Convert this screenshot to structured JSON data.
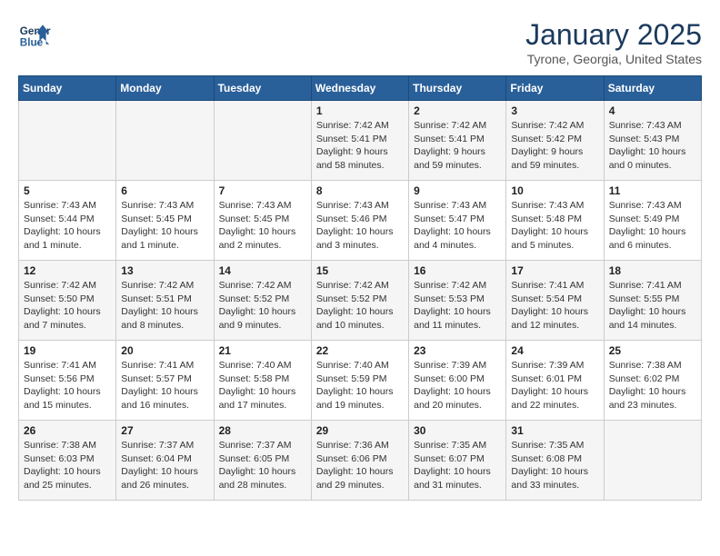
{
  "header": {
    "logo_line1": "General",
    "logo_line2": "Blue",
    "month": "January 2025",
    "location": "Tyrone, Georgia, United States"
  },
  "weekdays": [
    "Sunday",
    "Monday",
    "Tuesday",
    "Wednesday",
    "Thursday",
    "Friday",
    "Saturday"
  ],
  "weeks": [
    [
      {
        "day": "",
        "sunrise": "",
        "sunset": "",
        "daylight": ""
      },
      {
        "day": "",
        "sunrise": "",
        "sunset": "",
        "daylight": ""
      },
      {
        "day": "",
        "sunrise": "",
        "sunset": "",
        "daylight": ""
      },
      {
        "day": "1",
        "sunrise": "Sunrise: 7:42 AM",
        "sunset": "Sunset: 5:41 PM",
        "daylight": "Daylight: 9 hours and 58 minutes."
      },
      {
        "day": "2",
        "sunrise": "Sunrise: 7:42 AM",
        "sunset": "Sunset: 5:41 PM",
        "daylight": "Daylight: 9 hours and 59 minutes."
      },
      {
        "day": "3",
        "sunrise": "Sunrise: 7:42 AM",
        "sunset": "Sunset: 5:42 PM",
        "daylight": "Daylight: 9 hours and 59 minutes."
      },
      {
        "day": "4",
        "sunrise": "Sunrise: 7:43 AM",
        "sunset": "Sunset: 5:43 PM",
        "daylight": "Daylight: 10 hours and 0 minutes."
      }
    ],
    [
      {
        "day": "5",
        "sunrise": "Sunrise: 7:43 AM",
        "sunset": "Sunset: 5:44 PM",
        "daylight": "Daylight: 10 hours and 1 minute."
      },
      {
        "day": "6",
        "sunrise": "Sunrise: 7:43 AM",
        "sunset": "Sunset: 5:45 PM",
        "daylight": "Daylight: 10 hours and 1 minute."
      },
      {
        "day": "7",
        "sunrise": "Sunrise: 7:43 AM",
        "sunset": "Sunset: 5:45 PM",
        "daylight": "Daylight: 10 hours and 2 minutes."
      },
      {
        "day": "8",
        "sunrise": "Sunrise: 7:43 AM",
        "sunset": "Sunset: 5:46 PM",
        "daylight": "Daylight: 10 hours and 3 minutes."
      },
      {
        "day": "9",
        "sunrise": "Sunrise: 7:43 AM",
        "sunset": "Sunset: 5:47 PM",
        "daylight": "Daylight: 10 hours and 4 minutes."
      },
      {
        "day": "10",
        "sunrise": "Sunrise: 7:43 AM",
        "sunset": "Sunset: 5:48 PM",
        "daylight": "Daylight: 10 hours and 5 minutes."
      },
      {
        "day": "11",
        "sunrise": "Sunrise: 7:43 AM",
        "sunset": "Sunset: 5:49 PM",
        "daylight": "Daylight: 10 hours and 6 minutes."
      }
    ],
    [
      {
        "day": "12",
        "sunrise": "Sunrise: 7:42 AM",
        "sunset": "Sunset: 5:50 PM",
        "daylight": "Daylight: 10 hours and 7 minutes."
      },
      {
        "day": "13",
        "sunrise": "Sunrise: 7:42 AM",
        "sunset": "Sunset: 5:51 PM",
        "daylight": "Daylight: 10 hours and 8 minutes."
      },
      {
        "day": "14",
        "sunrise": "Sunrise: 7:42 AM",
        "sunset": "Sunset: 5:52 PM",
        "daylight": "Daylight: 10 hours and 9 minutes."
      },
      {
        "day": "15",
        "sunrise": "Sunrise: 7:42 AM",
        "sunset": "Sunset: 5:52 PM",
        "daylight": "Daylight: 10 hours and 10 minutes."
      },
      {
        "day": "16",
        "sunrise": "Sunrise: 7:42 AM",
        "sunset": "Sunset: 5:53 PM",
        "daylight": "Daylight: 10 hours and 11 minutes."
      },
      {
        "day": "17",
        "sunrise": "Sunrise: 7:41 AM",
        "sunset": "Sunset: 5:54 PM",
        "daylight": "Daylight: 10 hours and 12 minutes."
      },
      {
        "day": "18",
        "sunrise": "Sunrise: 7:41 AM",
        "sunset": "Sunset: 5:55 PM",
        "daylight": "Daylight: 10 hours and 14 minutes."
      }
    ],
    [
      {
        "day": "19",
        "sunrise": "Sunrise: 7:41 AM",
        "sunset": "Sunset: 5:56 PM",
        "daylight": "Daylight: 10 hours and 15 minutes."
      },
      {
        "day": "20",
        "sunrise": "Sunrise: 7:41 AM",
        "sunset": "Sunset: 5:57 PM",
        "daylight": "Daylight: 10 hours and 16 minutes."
      },
      {
        "day": "21",
        "sunrise": "Sunrise: 7:40 AM",
        "sunset": "Sunset: 5:58 PM",
        "daylight": "Daylight: 10 hours and 17 minutes."
      },
      {
        "day": "22",
        "sunrise": "Sunrise: 7:40 AM",
        "sunset": "Sunset: 5:59 PM",
        "daylight": "Daylight: 10 hours and 19 minutes."
      },
      {
        "day": "23",
        "sunrise": "Sunrise: 7:39 AM",
        "sunset": "Sunset: 6:00 PM",
        "daylight": "Daylight: 10 hours and 20 minutes."
      },
      {
        "day": "24",
        "sunrise": "Sunrise: 7:39 AM",
        "sunset": "Sunset: 6:01 PM",
        "daylight": "Daylight: 10 hours and 22 minutes."
      },
      {
        "day": "25",
        "sunrise": "Sunrise: 7:38 AM",
        "sunset": "Sunset: 6:02 PM",
        "daylight": "Daylight: 10 hours and 23 minutes."
      }
    ],
    [
      {
        "day": "26",
        "sunrise": "Sunrise: 7:38 AM",
        "sunset": "Sunset: 6:03 PM",
        "daylight": "Daylight: 10 hours and 25 minutes."
      },
      {
        "day": "27",
        "sunrise": "Sunrise: 7:37 AM",
        "sunset": "Sunset: 6:04 PM",
        "daylight": "Daylight: 10 hours and 26 minutes."
      },
      {
        "day": "28",
        "sunrise": "Sunrise: 7:37 AM",
        "sunset": "Sunset: 6:05 PM",
        "daylight": "Daylight: 10 hours and 28 minutes."
      },
      {
        "day": "29",
        "sunrise": "Sunrise: 7:36 AM",
        "sunset": "Sunset: 6:06 PM",
        "daylight": "Daylight: 10 hours and 29 minutes."
      },
      {
        "day": "30",
        "sunrise": "Sunrise: 7:35 AM",
        "sunset": "Sunset: 6:07 PM",
        "daylight": "Daylight: 10 hours and 31 minutes."
      },
      {
        "day": "31",
        "sunrise": "Sunrise: 7:35 AM",
        "sunset": "Sunset: 6:08 PM",
        "daylight": "Daylight: 10 hours and 33 minutes."
      },
      {
        "day": "",
        "sunrise": "",
        "sunset": "",
        "daylight": ""
      }
    ]
  ]
}
